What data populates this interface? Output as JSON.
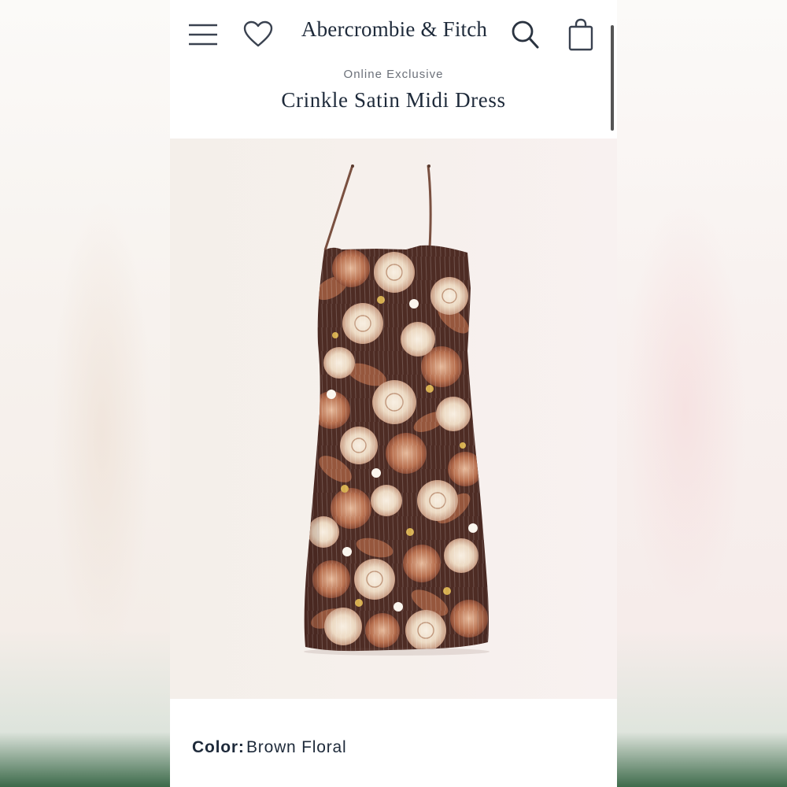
{
  "header": {
    "brand": "Abercrombie & Fitch",
    "icons": [
      "menu-icon",
      "heart-icon",
      "search-icon",
      "bag-icon"
    ]
  },
  "product": {
    "eyebrow": "Online Exclusive",
    "title": "Crinkle Satin Midi Dress",
    "image": {
      "subject": "floral slip midi dress",
      "palette": [
        "#5a3127",
        "#a8644a",
        "#e9d8c2",
        "#f6ede0",
        "#c9a24a"
      ]
    }
  },
  "color": {
    "label": "Color:",
    "value": "Brown Floral"
  },
  "colors": {
    "text": "#1e2a3a",
    "muted": "#6c717a",
    "image_bg": "#f5efeb"
  }
}
